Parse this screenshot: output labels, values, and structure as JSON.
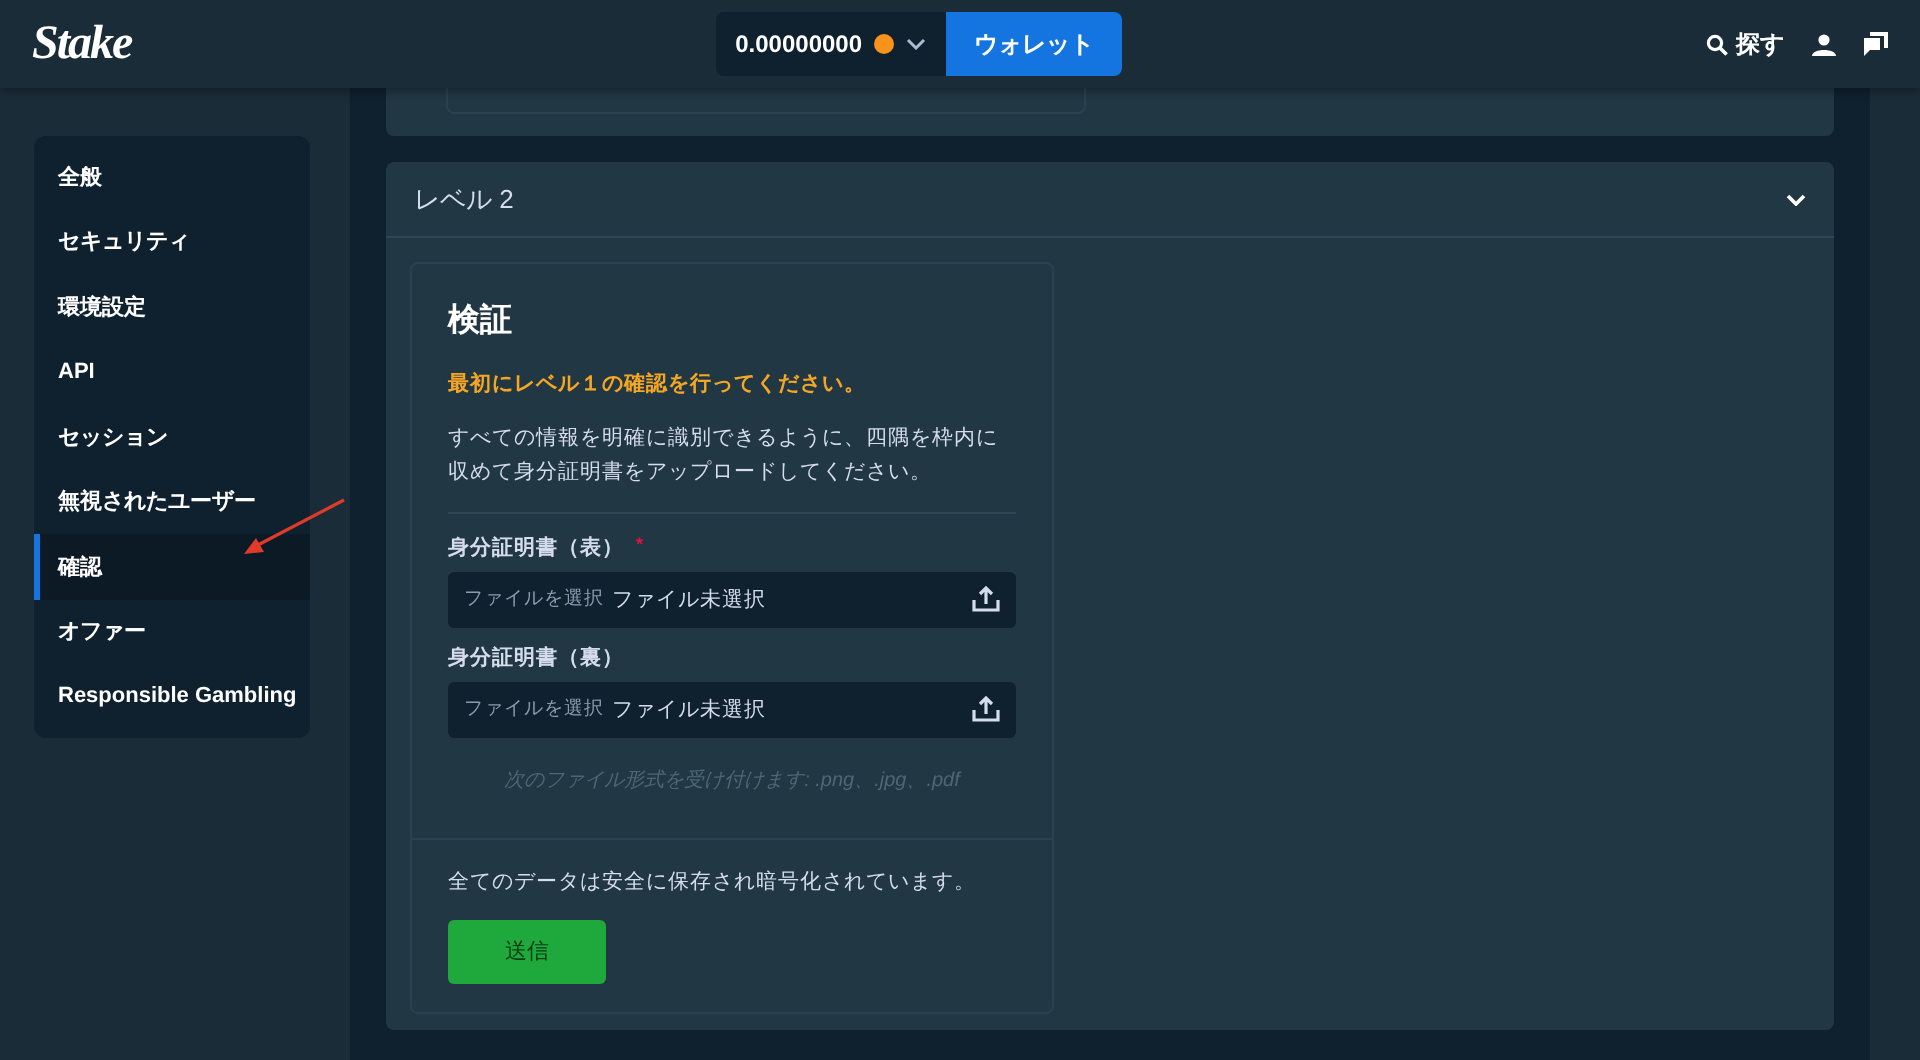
{
  "header": {
    "logo": "Stake",
    "balance": "0.00000000",
    "wallet_button": "ウォレット",
    "search_label": "探す"
  },
  "sidebar": {
    "items": [
      {
        "label": "全般",
        "selected": false
      },
      {
        "label": "セキュリティ",
        "selected": false
      },
      {
        "label": "環境設定",
        "selected": false
      },
      {
        "label": "API",
        "selected": false
      },
      {
        "label": "セッション",
        "selected": false
      },
      {
        "label": "無視されたユーザー",
        "selected": false
      },
      {
        "label": "確認",
        "selected": true
      },
      {
        "label": "オファー",
        "selected": false
      },
      {
        "label": "Responsible Gambling",
        "selected": false
      }
    ]
  },
  "level_section": {
    "title": "レベル 2",
    "expanded": true,
    "verification": {
      "title": "検証",
      "warning": "最初にレベル１の確認を行ってください。",
      "description": "すべての情報を明確に識別できるように、四隅を枠内に収めて身分証明書をアップロードしてください。",
      "fields": [
        {
          "label": "身分証明書（表）",
          "required_mark": "*",
          "choose_button": "ファイルを選択",
          "value": "ファイル未選択"
        },
        {
          "label": "身分証明書（裏）",
          "choose_button": "ファイルを選択",
          "value": "ファイル未選択"
        }
      ],
      "formats_note": "次のファイル形式を受け付けます: .png、.jpg、.pdf",
      "security_note": "全てのデータは安全に保存され暗号化されています。",
      "submit_button": "送信"
    }
  }
}
